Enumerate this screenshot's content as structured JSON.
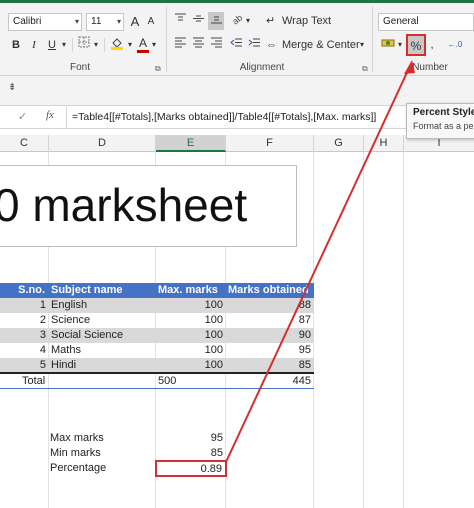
{
  "ribbon": {
    "font_name": "Calibri",
    "font_size": "11",
    "grow_font": "A",
    "shrink_font": "A",
    "bold": "B",
    "italic": "I",
    "underline": "U",
    "font_color_letter": "A",
    "wrap_text_label": "Wrap Text",
    "merge_center_label": "Merge & Center",
    "number_format": "General",
    "percent_symbol": "%",
    "groups": {
      "font": "Font",
      "alignment": "Alignment",
      "number": "Number"
    }
  },
  "tooltip": {
    "title": "Percent Style",
    "body": "Format as a pe"
  },
  "formula_bar": {
    "qat_glyph": "⇟",
    "cancel_glyph": "✓",
    "fx_label": "fx",
    "formula": "=Table4[[#Totals],[Marks obtained]]/Table4[[#Totals],[Max. marks]]"
  },
  "columns": [
    "C",
    "D",
    "E",
    "F",
    "G",
    "H",
    "I"
  ],
  "sheet": {
    "title_partial": "0 marksheet",
    "table": {
      "headers": [
        "S.no.",
        "Subject name",
        "Max. marks",
        "Marks obtained"
      ],
      "rows": [
        {
          "sno": "1",
          "subject": "English",
          "max": "100",
          "obtained": "88"
        },
        {
          "sno": "2",
          "subject": "Science",
          "max": "100",
          "obtained": "87"
        },
        {
          "sno": "3",
          "subject": "Social Science",
          "max": "100",
          "obtained": "90"
        },
        {
          "sno": "4",
          "subject": "Maths",
          "max": "100",
          "obtained": "95"
        },
        {
          "sno": "5",
          "subject": "Hindi",
          "max": "100",
          "obtained": "85"
        }
      ],
      "total_label": "Total",
      "total_max": "500",
      "total_obtained": "445"
    },
    "summary": [
      {
        "label": "Max marks",
        "value": "95"
      },
      {
        "label": "Min marks",
        "value": "85"
      },
      {
        "label": "Percentage",
        "value": "0.89"
      }
    ]
  },
  "colors": {
    "accent": "#217346",
    "table_header": "#4472c4",
    "band": "#d9d9d9",
    "highlight": "#d32f2f"
  }
}
